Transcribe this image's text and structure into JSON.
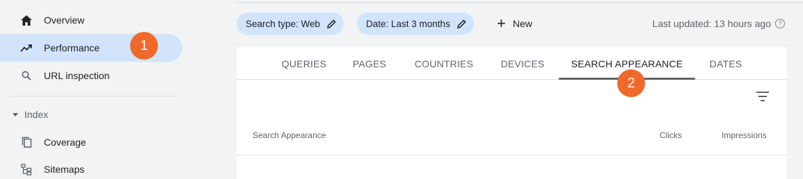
{
  "sidebar": {
    "items": [
      {
        "label": "Overview",
        "icon": "home-icon"
      },
      {
        "label": "Performance",
        "icon": "trending-up-icon"
      },
      {
        "label": "URL inspection",
        "icon": "search-icon"
      }
    ],
    "section": {
      "label": "Index"
    },
    "index_items": [
      {
        "label": "Coverage",
        "icon": "coverage-icon"
      },
      {
        "label": "Sitemaps",
        "icon": "sitemap-icon"
      }
    ]
  },
  "badges": {
    "one": "1",
    "two": "2"
  },
  "filters": {
    "search_type": "Search type: Web",
    "date": "Date: Last 3 months",
    "new": "New",
    "last_updated": "Last updated: 13 hours ago",
    "help": "?"
  },
  "tabs": [
    {
      "label": "QUERIES"
    },
    {
      "label": "PAGES"
    },
    {
      "label": "COUNTRIES"
    },
    {
      "label": "DEVICES"
    },
    {
      "label": "SEARCH APPEARANCE"
    },
    {
      "label": "DATES"
    }
  ],
  "table": {
    "headers": [
      "Search Appearance",
      "Clicks",
      "Impressions"
    ]
  },
  "colors": {
    "accent_chip": "#d2e3fc",
    "badge": "#f0692a",
    "background": "#f1f3f4"
  }
}
